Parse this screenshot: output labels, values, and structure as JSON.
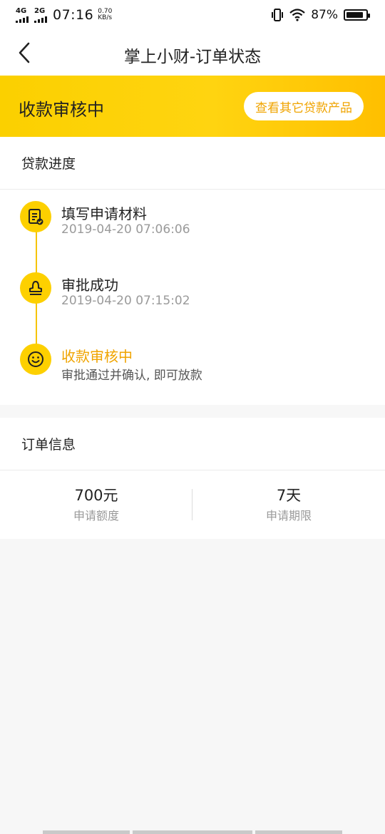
{
  "status_bar": {
    "network1": "4G",
    "network2": "2G",
    "time": "07:16",
    "speed_value": "0.70",
    "speed_unit": "KB/s",
    "battery_percent": "87%",
    "battery_level": 0.87
  },
  "navbar": {
    "title": "掌上小财-订单状态",
    "back_icon": "chevron-left-icon"
  },
  "banner": {
    "status": "收款审核中",
    "button_label": "查看其它贷款产品",
    "gradient": [
      "#fbd000",
      "#ffbf00"
    ]
  },
  "progress": {
    "header": "贷款进度",
    "steps": [
      {
        "title": "填写申请材料",
        "subtitle": "2019-04-20 07:06:06",
        "icon": "document-check-icon",
        "active": false
      },
      {
        "title": "审批成功",
        "subtitle": "2019-04-20 07:15:02",
        "icon": "stamp-icon",
        "active": false
      },
      {
        "title": "收款审核中",
        "subtitle": "审批通过并确认, 即可放款",
        "icon": "smiley-icon",
        "active": true
      }
    ]
  },
  "order_info": {
    "header": "订单信息",
    "items": [
      {
        "value": "700元",
        "label": "申请额度"
      },
      {
        "value": "7天",
        "label": "申请期限"
      }
    ]
  },
  "colors": {
    "accent": "#fdd000",
    "accent_text": "#f0a400",
    "background": "#f7f7f7"
  }
}
